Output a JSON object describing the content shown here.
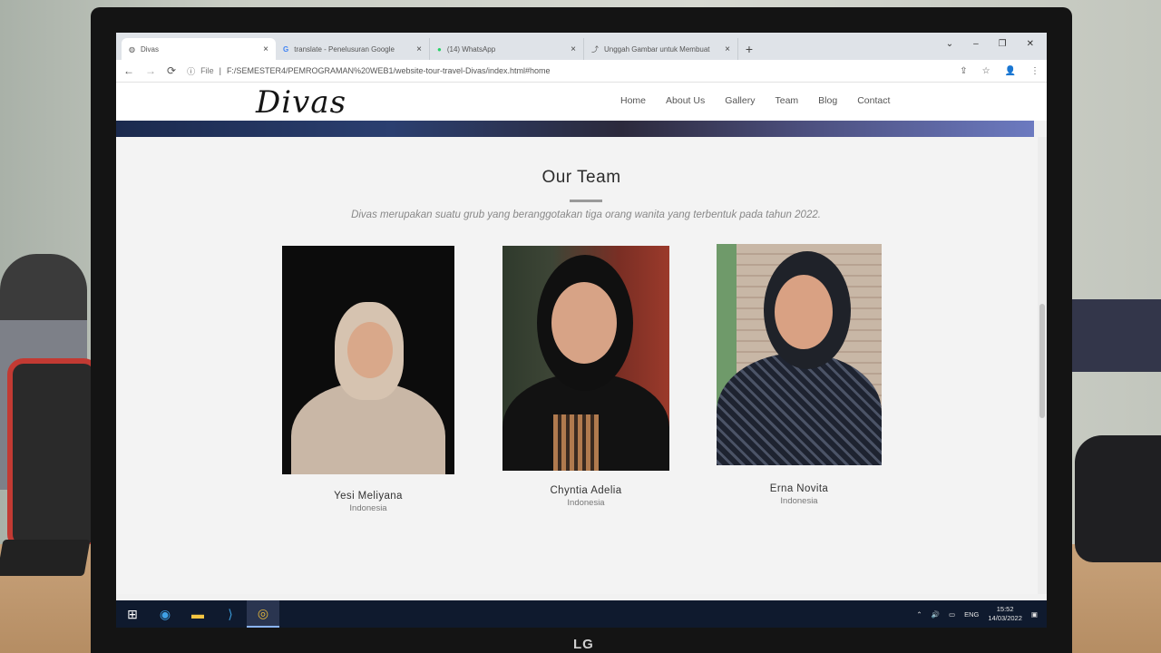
{
  "browser": {
    "tabs": [
      {
        "title": "Divas",
        "icon": "globe-icon",
        "active": true
      },
      {
        "title": "translate - Penelusuran Google",
        "icon": "google-icon",
        "active": false
      },
      {
        "title": "(14) WhatsApp",
        "icon": "whatsapp-icon",
        "active": false
      },
      {
        "title": "Unggah Gambar untuk Membuat",
        "icon": "upload-icon",
        "active": false
      }
    ],
    "new_tab": "+",
    "window_controls": {
      "minimize": "–",
      "restore": "❐",
      "close": "✕"
    },
    "scheme": "File",
    "url": "F:/SEMESTER4/PEMROGRAMAN%20WEB1/website-tour-travel-Divas/index.html#home",
    "nav": {
      "back": "←",
      "forward": "→",
      "reload": "⟳",
      "info": "ⓘ"
    },
    "addr_icons": {
      "share": "⇪",
      "star": "☆",
      "profile": "👤",
      "menu": "⋮"
    }
  },
  "site": {
    "logo": "Divas",
    "menu": [
      "Home",
      "About Us",
      "Gallery",
      "Team",
      "Blog",
      "Contact"
    ]
  },
  "team": {
    "title": "Our Team",
    "subtitle": "Divas merupakan suatu grub yang beranggotakan tiga orang wanita yang terbentuk pada tahun 2022.",
    "members": [
      {
        "name": "Yesi Meliyana",
        "country": "Indonesia"
      },
      {
        "name": "Chyntia Adelia",
        "country": "Indonesia"
      },
      {
        "name": "Erna Novita",
        "country": "Indonesia"
      }
    ]
  },
  "taskbar": {
    "icons": [
      "windows-start-icon",
      "edge-icon",
      "file-explorer-icon",
      "vscode-icon",
      "chrome-icon"
    ],
    "language": "ENG",
    "time": "15:52",
    "date": "14/03/2022"
  },
  "monitor": {
    "brand": "LG"
  },
  "colors": {
    "accent_line": "#9a9a9a",
    "taskbar": "#0f1a2e"
  }
}
